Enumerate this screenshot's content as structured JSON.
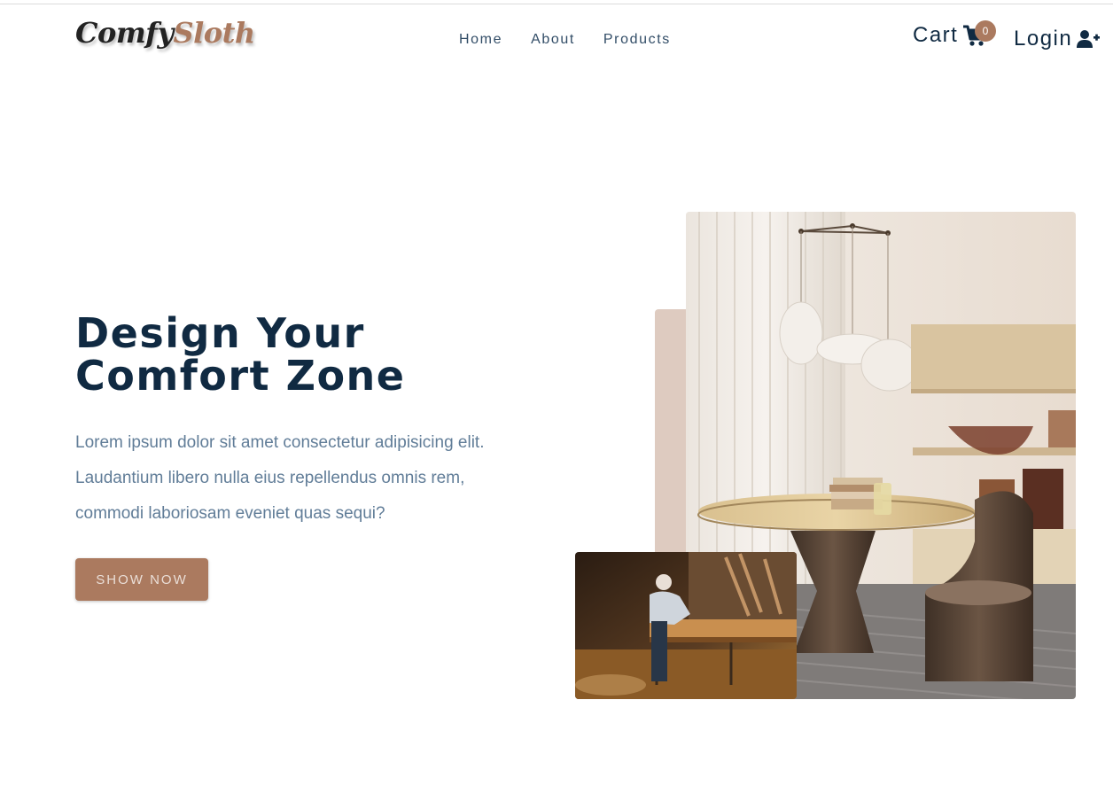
{
  "navbar": {
    "logo": {
      "part1": "Comfy",
      "part2": "Sloth"
    },
    "links": [
      {
        "label": "Home"
      },
      {
        "label": "About"
      },
      {
        "label": "Products"
      }
    ],
    "cart": {
      "label": "Cart",
      "count": "0",
      "icon": "cart-icon"
    },
    "login": {
      "label": "Login",
      "icon": "user-plus-icon"
    }
  },
  "hero": {
    "title_line1": "Design Your",
    "title_line2": "Comfort Zone",
    "text": "Lorem ipsum dolor sit amet consectetur adipisicing elit. Laudantium libero nulla eius repellendus omnis rem, commodi laboriosam eveniet quas sequi?",
    "button_label": "SHOW NOW"
  },
  "colors": {
    "brand": "#ab7a5f",
    "heading": "#102a42",
    "body_text": "#617d98",
    "accent_block": "#decbc0"
  }
}
